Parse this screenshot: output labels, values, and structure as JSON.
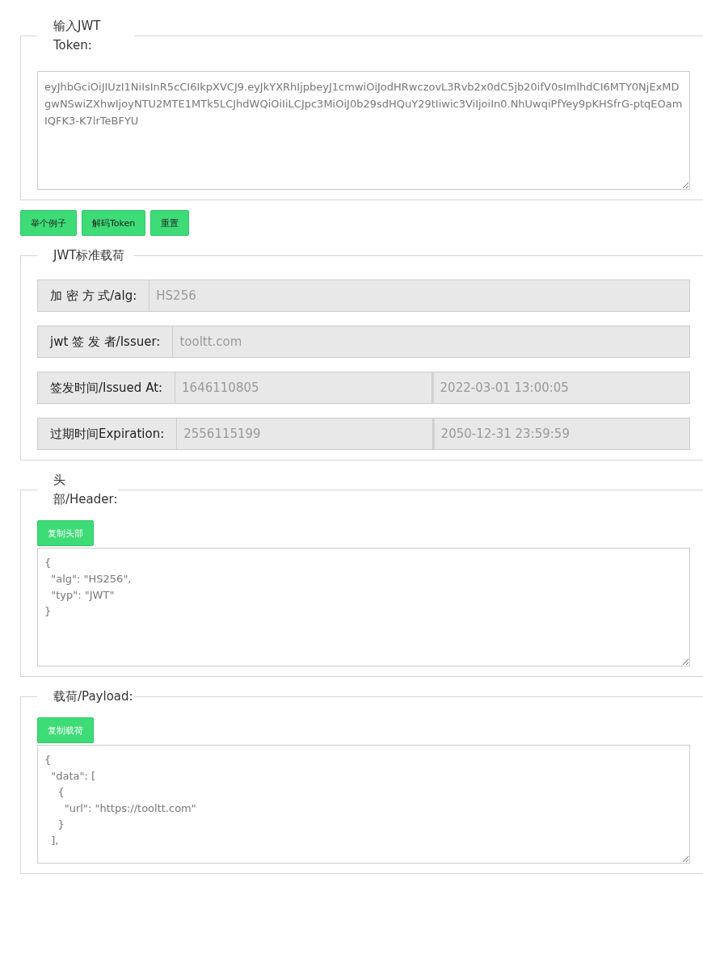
{
  "token_section": {
    "legend": "输入JWT Token:",
    "value": "eyJhbGciOiJIUzI1NiIsInR5cCI6IkpXVCJ9.eyJkYXRhIjpbeyJ1cmwiOiJodHRwczovL3Rvb2x0dC5jb20ifV0sImlhdCI6MTY0NjExMDgwNSwiZXhwIjoyNTU2MTE1MTk5LCJhdWQiOiIiLCJpc3MiOiJ0b29sdHQuY29tIiwic3ViIjoiIn0.NhUwqiPfYey9pKHSfrG-ptqEOamIQFK3-K7lrTeBFYU"
  },
  "buttons": [
    "举个例子",
    "解码Token",
    "重置"
  ],
  "claims": {
    "legend": "JWT标准载荷",
    "rows": [
      {
        "label": "加 密 方 式/alg:",
        "values": [
          "HS256"
        ]
      },
      {
        "label": "jwt 签 发 者/Issuer:",
        "values": [
          "tooltt.com"
        ]
      },
      {
        "label": "签发时间/Issued At:",
        "values": [
          "1646110805",
          "2022-03-01 13:00:05"
        ]
      },
      {
        "label": "过期时间Expiration:",
        "values": [
          "2556115199",
          "2050-12-31 23:59:59"
        ]
      }
    ]
  },
  "header_section": {
    "legend": "头部/Header:",
    "copy_button": "复制头部",
    "content": "{\n  \"alg\": \"HS256\",\n  \"typ\": \"JWT\"\n}"
  },
  "payload_section": {
    "legend": "载荷/Payload:",
    "copy_button": "复制载荷",
    "content": "{\n  \"data\": [\n    {\n      \"url\": \"https://tooltt.com\"\n    }\n  ],"
  }
}
